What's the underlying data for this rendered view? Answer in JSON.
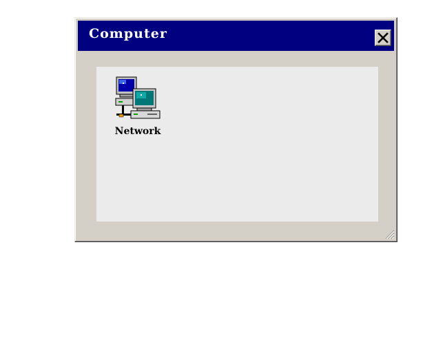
{
  "window": {
    "title": "Computer",
    "close_icon": "close-icon",
    "resize_icon": "resize-grip-icon"
  },
  "content": {
    "items": [
      {
        "label": "Network",
        "icon": "network-computers-icon"
      }
    ]
  },
  "colors": {
    "titlebar": "#000080",
    "title_text": "#ffffff",
    "frame": "#d4d0c8",
    "content_bg": "#ebebeb",
    "page_bg": "#ffffff"
  }
}
